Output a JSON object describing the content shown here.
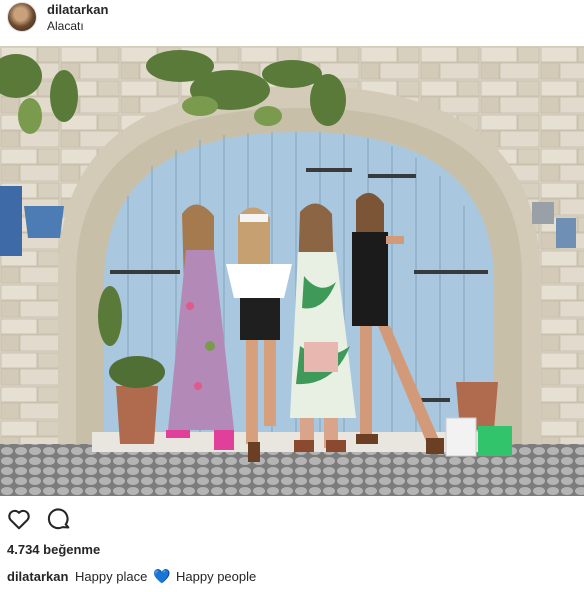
{
  "post": {
    "username": "dilatarkan",
    "location": "Alacatı"
  },
  "photo": {
    "alt_subject": "group-photo",
    "colors": {
      "door": "#a9c8df",
      "stone": "#ddd6c8",
      "cobble": "#8e8e8e",
      "foliage": "#5a7a3a"
    }
  },
  "actions": {
    "like_icon": "heart-outline-icon",
    "comment_icon": "comment-bubble-icon"
  },
  "likes_text": "4.734 beğenme",
  "caption": {
    "username": "dilatarkan",
    "text_before": "Happy place",
    "emoji": "💙",
    "text_after": "Happy people"
  }
}
